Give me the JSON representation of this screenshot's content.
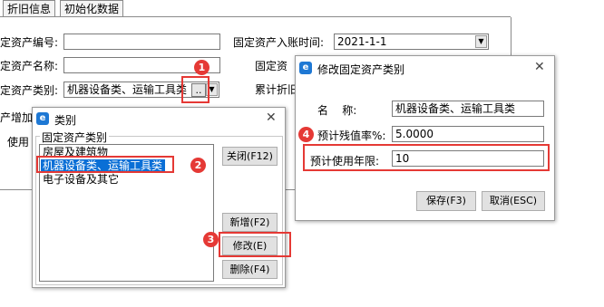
{
  "tabs": [
    {
      "label": "折旧信息"
    },
    {
      "label": "初始化数据"
    }
  ],
  "form": {
    "asset_no_label": "定资产编号:",
    "asset_name_label": "定资产名称:",
    "asset_category_label": "定资产类别:",
    "asset_category_value": "机器设备类、运输工具类",
    "browse_label": "..",
    "increase_label": "产增加",
    "use_label": "使用",
    "entry_time_label": "固定资产入账时间:",
    "entry_time_value": "2021-1-1",
    "fixed_asset_label2": "固定资",
    "accumulated_label": "累计折旧"
  },
  "category_dialog": {
    "title": "类别",
    "group_label": "固定资产类别",
    "items": [
      {
        "label": "房屋及建筑物"
      },
      {
        "label": "机器设备类、运输工具类"
      },
      {
        "label": "电子设备及其它"
      }
    ],
    "close_button": "关闭(F12)",
    "new_button": "新增(F2)",
    "edit_button": "修改(E)",
    "delete_button": "删除(F4)"
  },
  "edit_dialog": {
    "title": "修改固定资产类别",
    "name_label": "名    称:",
    "name_value": "机器设备类、运输工具类",
    "residual_label": "预计残值率%:",
    "residual_value": "5.0000",
    "years_label": "预计使用年限:",
    "years_value": "10",
    "save_button": "保存(F3)",
    "cancel_button": "取消(ESC)"
  },
  "annotations": [
    "1",
    "2",
    "3",
    "4"
  ],
  "colors": {
    "highlight": "#e53935",
    "selection": "#0a6fd6",
    "app_icon": "#1e78d4"
  }
}
